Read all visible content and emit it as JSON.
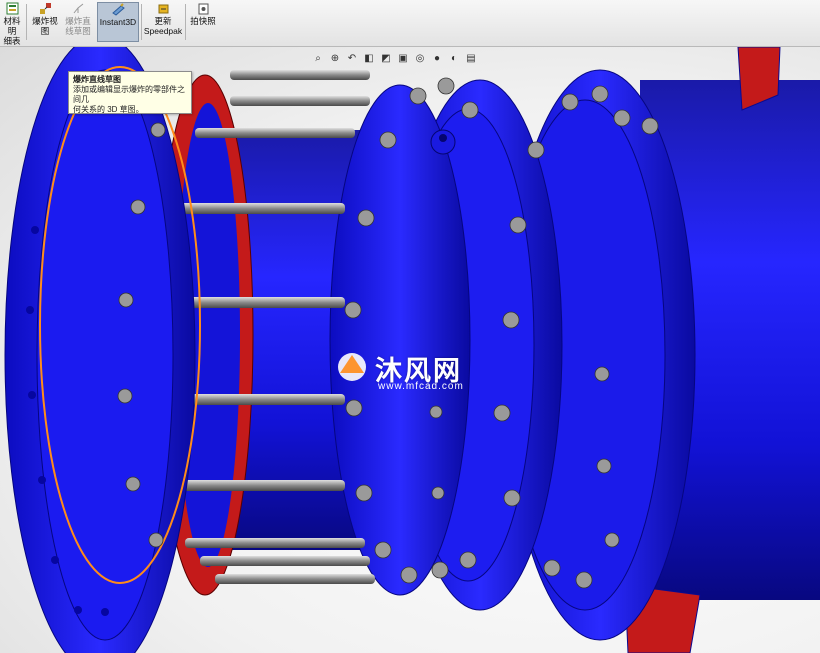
{
  "toolbar": {
    "buttons": [
      {
        "id": "bom",
        "label_line1": "材料明",
        "label_line2": "细表",
        "icon": "bom-icon",
        "state": "normal"
      },
      {
        "id": "exploded",
        "label_line1": "爆炸视",
        "label_line2": "图",
        "icon": "explode-icon",
        "state": "normal"
      },
      {
        "id": "explode_line",
        "label_line1": "爆炸直",
        "label_line2": "线草图",
        "icon": "explode-line-sketch-icon",
        "state": "disabled"
      },
      {
        "id": "instant3d",
        "label_line1": "Instant3D",
        "label_line2": "",
        "icon": "instant3d-icon",
        "state": "active"
      },
      {
        "id": "speedpak",
        "label_line1": "更新",
        "label_line2": "Speedpak",
        "icon": "speedpak-icon",
        "state": "normal"
      },
      {
        "id": "snapshot",
        "label_line1": "拍快照",
        "label_line2": "",
        "icon": "camera-icon",
        "state": "normal"
      }
    ]
  },
  "tooltip": {
    "title": "爆炸直线草图",
    "line1": "添加或编辑显示爆炸的零部件之间几",
    "line2": "何关系的 3D 草图。"
  },
  "heads_up_toolbar": [
    "zoom-to-fit-icon",
    "zoom-area-icon",
    "previous-view-icon",
    "section-view-icon",
    "view-orientation-icon",
    "display-style-icon",
    "hide-show-icon",
    "edit-appearance-icon",
    "apply-scene-icon",
    "view-settings-icon"
  ],
  "watermark": {
    "text_cn": "沐风网",
    "url": "www.mfcad.com"
  },
  "colors": {
    "part_blue": "#1010e0",
    "gasket_red": "#c41a1a",
    "rod_gray": "#9a9a9a",
    "highlight_orange": "#ff8c1a",
    "toolbar_bg": "#ececec",
    "active_button": "#b9c6d6"
  }
}
